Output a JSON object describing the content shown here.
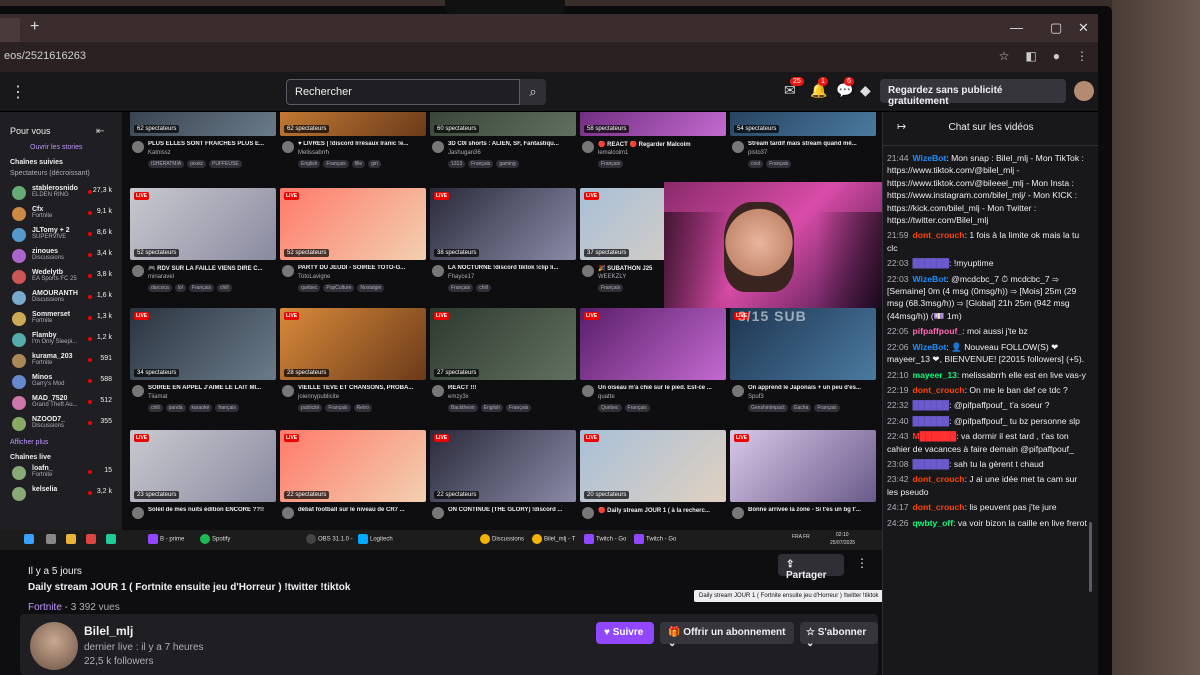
{
  "browser": {
    "url": "eos/2521616263",
    "new_tab": "+"
  },
  "header": {
    "search_placeholder": "Rechercher",
    "notif_badges": [
      "25",
      "1",
      "6"
    ],
    "adfree_label": "Regardez sans publicité gratuitement"
  },
  "sidebar": {
    "title": "Pour vous",
    "stories_label": "Ouvrir les stories",
    "followed_title": "Chaînes suivies",
    "followed_sub": "Spectateurs (décroissant)",
    "channels": [
      {
        "name": "stablerosnido",
        "game": "ELDEN RING",
        "viewers": "27,3 k"
      },
      {
        "name": "Cfx",
        "game": "Fortnite",
        "viewers": "9,1 k"
      },
      {
        "name": "JLTomy + 2",
        "game": "SUPERVIVE",
        "viewers": "8,6 k"
      },
      {
        "name": "zinoues",
        "game": "Discussions",
        "viewers": "3,4 k"
      },
      {
        "name": "Wedelytb",
        "game": "EA Sports FC 25",
        "viewers": "3,8 k"
      },
      {
        "name": "AMOURANTH",
        "game": "Discussions",
        "viewers": "1,6 k"
      },
      {
        "name": "Sommerset",
        "game": "Fortnite",
        "viewers": "1,3 k"
      },
      {
        "name": "Flamby",
        "game": "I'm Only Sleepi...",
        "viewers": "1,2 k"
      },
      {
        "name": "kurama_203",
        "game": "Fortnite",
        "viewers": "591"
      },
      {
        "name": "Minos",
        "game": "Garry's Mod",
        "viewers": "588"
      },
      {
        "name": "MAD_7520",
        "game": "Grand Theft Au...",
        "viewers": "512"
      },
      {
        "name": "NZOOD7_",
        "game": "Discussions",
        "viewers": "355"
      }
    ],
    "show_more": "Afficher plus",
    "live_title": "Chaînes live",
    "live_channels": [
      {
        "name": "loafn_",
        "game": "Fortnite",
        "viewers": "15"
      },
      {
        "name": "kelselia",
        "game": "",
        "viewers": "3,2 k"
      }
    ]
  },
  "grid": {
    "live_label": "LIVE",
    "top_row": [
      {
        "viewers": "62 spectateurs",
        "title": "PLUS ELLES SONT FRAICHES PLUS E...",
        "channel": "Katnissz",
        "tags": [
          "ISHERATMIA",
          "pixelz",
          "PUFFEUSE"
        ]
      },
      {
        "viewers": "62 spectateurs",
        "title": "♥ LIVRES | !discord Irrésaux Iranic !e...",
        "channel": "Melissabrrh",
        "tags": [
          "English",
          "Français",
          "fille",
          "girl"
        ]
      },
      {
        "viewers": "60 spectateurs",
        "title": "3D C0I shorts : ALIEN, SF, Fantastiqu...",
        "channel": "Jashugan36",
        "tags": [
          "1313",
          "Français",
          "gaming"
        ]
      },
      {
        "viewers": "58 spectateurs",
        "title": "🔴 REACT 🔴 Regarder Malcoim",
        "channel": "lemalcolm1",
        "tags": [
          "Français"
        ]
      },
      {
        "viewers": "54 spectateurs",
        "title": "Stream tardif mais stream quand mê...",
        "channel": "pisto37",
        "tags": [
          "cool",
          "Français"
        ]
      }
    ],
    "row2": [
      {
        "viewers": "52 spectateurs",
        "title": "🎮 RDV SUR LA FAILLE VIENS DIRE C...",
        "channel": "minaravel",
        "tags": [
          "darcoca",
          "lol",
          "Français",
          "chill"
        ]
      },
      {
        "viewers": "52 spectateurs",
        "title": "PARTY DU JEUDI - SOIRÉE TOTO-G...",
        "channel": "TotoLavigne",
        "tags": [
          "québec",
          "PopCulture",
          "Nostalgie"
        ]
      },
      {
        "viewers": "38 spectateurs",
        "title": "LA NOCTURNE !discord tiktok !clip li...",
        "channel": "Fhayce17",
        "tags": [
          "Français",
          "chill"
        ]
      },
      {
        "viewers": "37 spectateurs",
        "title": "🎉 SUBATHON J25",
        "channel": "WEEKZLY",
        "tags": [
          "Français"
        ]
      }
    ],
    "row3": [
      {
        "viewers": "34 spectateurs",
        "title": "SOIRÉE EN APPEL J'AIME LE LAIT MI...",
        "channel": "Tiiamat",
        "tags": [
          "chill",
          "panda",
          "karaoké",
          "français"
        ]
      },
      {
        "viewers": "28 spectateurs",
        "title": "VIEILLE TÉVÉ ET CHANSONS, PROBA...",
        "channel": "joiennypublicite",
        "tags": [
          "publicité",
          "Français",
          "Retro"
        ]
      },
      {
        "viewers": "27 spectateurs",
        "title": "REACT !!!",
        "channel": "emzy3x",
        "tags": [
          "Backtheon",
          "English",
          "Français"
        ]
      },
      {
        "viewers": "",
        "title": "Un oiseau m'a chié sur le pied. Est-ce ...",
        "channel": "quatte",
        "tags": [
          "Québec",
          "Français"
        ]
      },
      {
        "viewers": "",
        "title": "On apprend le Japonais + un peu d'es...",
        "channel": "Spuf3",
        "tags": [
          "GenshinImpact",
          "Gacha",
          "Français"
        ]
      }
    ],
    "row4": [
      {
        "viewers": "23 spectateurs",
        "title": "Soleil de mes nuits édition ENCORE ??!!",
        "channel": "",
        "tags": []
      },
      {
        "viewers": "22 spectateurs",
        "title": "débat football sur le niveau de CR7 ...",
        "channel": "",
        "tags": []
      },
      {
        "viewers": "22 spectateurs",
        "title": "ON CONTINUE (THE GLORY) !discord ...",
        "channel": "",
        "tags": []
      },
      {
        "viewers": "20 spectateurs",
        "title": "🔴 Daily stream JOUR 1 ( à la recherc...",
        "channel": "",
        "tags": []
      },
      {
        "viewers": "",
        "title": "Bonne arrivée la zone - Si t'es un bg t'...",
        "channel": "",
        "tags": []
      }
    ],
    "player_overlay": "3/15 SUB"
  },
  "taskbar": {
    "items": [
      "B - prime",
      "Spotify",
      "OBS 31.1.0 -",
      "Logitech",
      "Discussions",
      "Bilel_mlj - T",
      "Twitch - Go",
      "Twitch - Go"
    ],
    "lang": "FRA\nFR",
    "time": "02:10",
    "date": "25/07/2025"
  },
  "vod": {
    "age": "Il y a 5 jours",
    "title": "Daily stream JOUR 1 ( Fortnite ensuite jeu d'Horreur ) !twitter !tiktok",
    "game": "Fortnite",
    "views": " - 3 392 vues",
    "share": "Partager",
    "tooltip": "Daily stream JOUR 1 ( Fortnite ensuite jeu d'Horreur ) !twitter !tiktok"
  },
  "channel": {
    "name": "Bilel_mlj",
    "last_live": "dernier live : il y a 7 heures",
    "followers": "22,5 k followers",
    "follow": "Suivre",
    "gift": "Offrir un abonnement",
    "subscribe": "S'abonner"
  },
  "chat": {
    "title": "Chat sur les vidéos",
    "messages": [
      {
        "t": "21:44",
        "u": "WizeBot",
        "c": "u-wize",
        "m": ": Mon snap : Bilel_mlj - Mon TikTok : https://www.tiktok.com/@bilel_mlj - https://www.tiktok.com/@bileeel_mlj - Mon Insta : https://www.instagram.com/bilel_mlj/ - Mon KICK : https://kick.com/bilel_mlj - Mon Twitter : https://twitter.com/Bilel_mlj"
      },
      {
        "t": "21:59",
        "u": "dont_crouch",
        "c": "u-orange",
        "m": ": 1 fois à la limite ok mais la tu clc"
      },
      {
        "t": "22:03",
        "u": "██████",
        "c": "u-blue",
        "m": ": !myuptime"
      },
      {
        "t": "22:03",
        "u": "WizeBot",
        "c": "u-wize",
        "m": ": @mcdcbc_7 ⏱ mcdcbc_7 ⇒ [Semaine] 0m (4 msg (0msg/h)) ⇒ [Mois] 25m (29 msg (68.3msg/h)) ⇒ [Global] 21h 25m (942 msg (44msg/h)) (💷 1m)"
      },
      {
        "t": "22:05",
        "u": "pifpaffpouf_",
        "c": "u-pink",
        "m": ": moi aussi j'te bz"
      },
      {
        "t": "22:06",
        "u": "WizeBot",
        "c": "u-wize",
        "m": ": 👤 Nouveau FOLLOW(S) ❤ mayeer_13 ❤, BIENVENUE! [22015 followers] (+5)."
      },
      {
        "t": "22:10",
        "u": "mayeer_13",
        "c": "u-green",
        "m": ": melissabrrh elle est en live vas-y"
      },
      {
        "t": "22:19",
        "u": "dont_crouch",
        "c": "u-orange",
        "m": ": On me le ban def ce tdc ?"
      },
      {
        "t": "22:32",
        "u": "██████",
        "c": "u-blue",
        "m": ": @pifpaffpouf_ t'a soeur ?"
      },
      {
        "t": "22:40",
        "u": "██████",
        "c": "u-blue",
        "m": ": @pifpaffpouf_ tu bz personne slp"
      },
      {
        "t": "22:43",
        "u": "M██████",
        "c": "u-red",
        "m": ": va dormir il est tard , t'as ton cahier de vacances à faire demain @pifpaffpouf_"
      },
      {
        "t": "23:08",
        "u": "██████",
        "c": "u-blue",
        "m": ": sah tu la gèrent t chaud"
      },
      {
        "t": "23:42",
        "u": "dont_crouch",
        "c": "u-orange",
        "m": ": J ai une idée met ta cam sur les pseudo"
      },
      {
        "t": "24:17",
        "u": "dont_crouch",
        "c": "u-orange",
        "m": ": lis peuvent pas j'te jure"
      },
      {
        "t": "24:26",
        "u": "qwbty_off",
        "c": "u-green",
        "m": ": va voir bizon la caille en live frerot"
      }
    ]
  }
}
